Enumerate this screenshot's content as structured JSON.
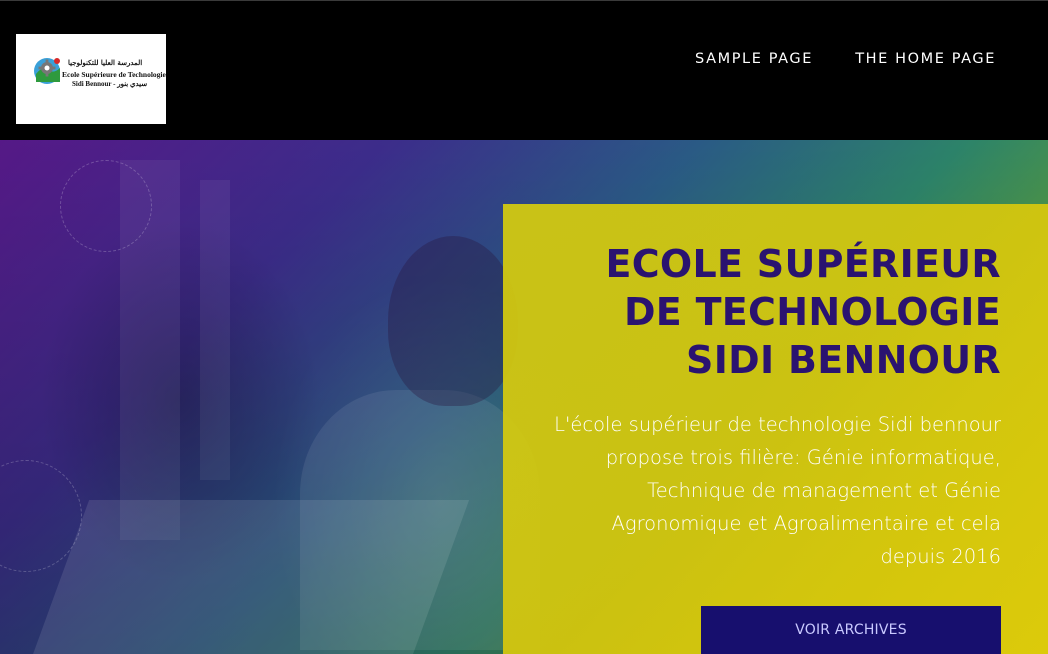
{
  "header": {
    "logo": {
      "alt": "Ecole Supérieure de Technologie Sidi Bennour logo",
      "arabic_name": "المدرسة العليا للتكنولوجيا",
      "french_name": "Ecole Supérieure de Technologie",
      "city_line": "Sidi Bennour - سيدي بنور"
    },
    "nav": [
      {
        "label": "SAMPLE PAGE"
      },
      {
        "label": "THE HOME PAGE"
      }
    ]
  },
  "hero": {
    "title_lines": [
      "ECOLE SUPÉRIEUR",
      "DE TECHNOLOGIE",
      "SIDI BENNOUR"
    ],
    "description": "L'école supérieur de technologie Sidi bennour propose trois filière: Génie informatique, Technique de management et Génie Agronomique et Agroalimentaire et cela depuis 2016",
    "cta_label": "VOIR ARCHIVES"
  },
  "colors": {
    "header_bg": "#000000",
    "nav_text": "#ffffff",
    "panel_yellow": "#d6cd0e",
    "title_purple": "#2a1370",
    "cta_bg": "#170f6e",
    "cta_text": "#c9c9ff"
  }
}
